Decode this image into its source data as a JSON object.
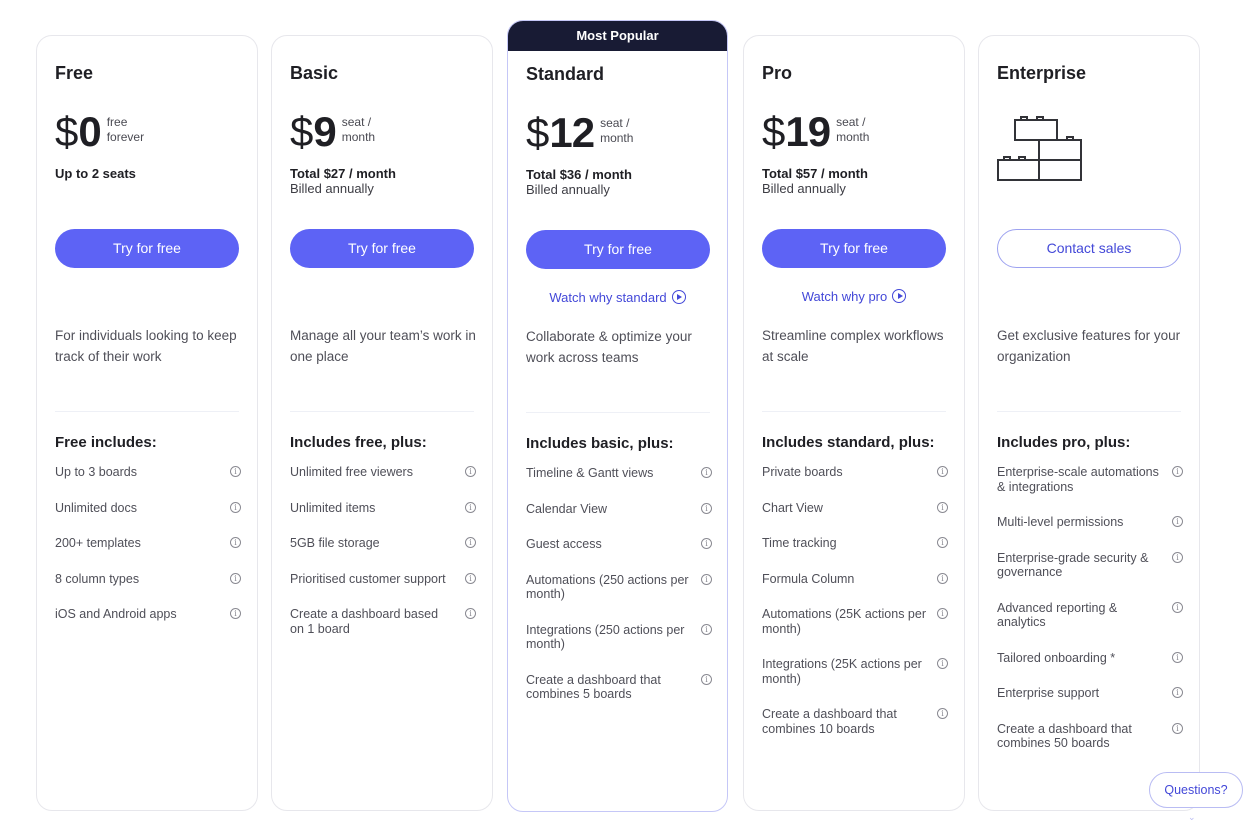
{
  "popular_badge": "Most Popular",
  "colors": {
    "accent": "#5d63f5",
    "badge_bg": "#181b34",
    "link": "#4348d8"
  },
  "plans": [
    {
      "name": "Free",
      "currency": "$",
      "price": "0",
      "unit_line1": "free",
      "unit_line2": "forever",
      "seats": "Up to 2 seats",
      "cta": "Try for free",
      "description": "For individuals looking to keep track of their work",
      "includes_title": "Free includes:",
      "features": [
        "Up to 3 boards",
        "Unlimited docs",
        "200+ templates",
        "8 column types",
        "iOS and Android apps"
      ]
    },
    {
      "name": "Basic",
      "currency": "$",
      "price": "9",
      "unit_line1": "seat /",
      "unit_line2": "month",
      "total": "Total $27 / month",
      "billing": "Billed annually",
      "cta": "Try for free",
      "description": "Manage all your team’s work in one place",
      "includes_title": "Includes free, plus:",
      "features": [
        "Unlimited free viewers",
        "Unlimited items",
        "5GB file storage",
        "Prioritised customer support",
        "Create a dashboard based on 1 board"
      ]
    },
    {
      "name": "Standard",
      "currency": "$",
      "price": "12",
      "unit_line1": "seat /",
      "unit_line2": "month",
      "total": "Total $36 / month",
      "billing": "Billed annually",
      "cta": "Try for free",
      "watch": "Watch why standard",
      "description": "Collaborate & optimize your work across teams",
      "includes_title": "Includes basic, plus:",
      "features": [
        "Timeline & Gantt views",
        "Calendar View",
        "Guest access",
        "Automations (250 actions per month)",
        "Integrations (250 actions per month)",
        "Create a dashboard that combines 5 boards"
      ]
    },
    {
      "name": "Pro",
      "currency": "$",
      "price": "19",
      "unit_line1": "seat /",
      "unit_line2": "month",
      "total": "Total $57 / month",
      "billing": "Billed annually",
      "cta": "Try for free",
      "watch": "Watch why pro",
      "description": "Streamline complex workflows at scale",
      "includes_title": "Includes standard, plus:",
      "features": [
        "Private boards",
        "Chart View",
        "Time tracking",
        "Formula Column",
        "Automations (25K actions per month)",
        "Integrations (25K actions per month)",
        "Create a dashboard that combines 10 boards"
      ]
    },
    {
      "name": "Enterprise",
      "icon": "building-blocks-icon",
      "cta": "Contact sales",
      "description": "Get exclusive features for your organization",
      "includes_title": "Includes pro, plus:",
      "features": [
        "Enterprise-scale automations & integrations",
        "Multi-level permissions",
        "Enterprise-grade security & governance",
        "Advanced reporting & analytics",
        "Tailored onboarding *",
        "Enterprise support",
        "Create a dashboard that combines 50 boards"
      ]
    }
  ],
  "questions_button": "Questions?",
  "info_glyph": "i"
}
